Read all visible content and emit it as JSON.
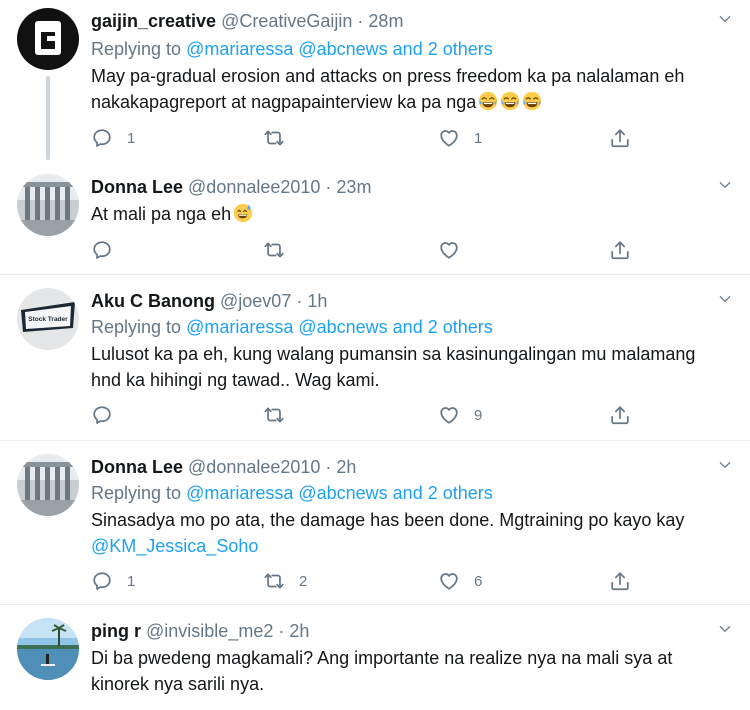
{
  "tweets": [
    {
      "name": "gaijin_creative",
      "handle": "@CreativeGaijin",
      "dot": " · ",
      "time": "28m",
      "replying_prefix": "Replying to ",
      "replying_users": "@mariaressa @abcnews and 2 others",
      "text_line1": "May pa-gradual erosion and attacks on press freedom ka pa nalalaman eh",
      "text_line2": "nakakapagreport at nagpapainterview ka pa nga",
      "emojis": [
        "face-with-tears-of-joy",
        "face-with-tears-of-joy",
        "face-with-tears-of-joy"
      ],
      "reply_count": "1",
      "retweet_count": "",
      "like_count": "1"
    },
    {
      "name": "Donna Lee",
      "handle": "@donnalee2010",
      "dot": " · ",
      "time": "23m",
      "text_line1": "At mali pa nga eh",
      "emojis": [
        "grinning-face-with-sweat"
      ],
      "reply_count": "",
      "retweet_count": "",
      "like_count": ""
    },
    {
      "name": "Aku C Banong",
      "handle": "@joev07",
      "dot": " · ",
      "time": "1h",
      "replying_prefix": "Replying to ",
      "replying_users": "@mariaressa @abcnews and 2 others",
      "text_line1": "Lulusot ka pa eh, kung walang pumansin sa kasinungalingan mu malamang",
      "text_line2": "hnd ka hihingi ng tawad.. Wag kami.",
      "avatar_text": "Stock Trader",
      "reply_count": "",
      "retweet_count": "",
      "like_count": "9"
    },
    {
      "name": "Donna Lee",
      "handle": "@donnalee2010",
      "dot": " · ",
      "time": "2h",
      "replying_prefix": "Replying to ",
      "replying_users": "@mariaressa @abcnews and 2 others",
      "text_line1": "Sinasadya mo po ata, the damage has been done. Mgtraining po kayo kay",
      "text_mention": "@KM_Jessica_Soho",
      "reply_count": "1",
      "retweet_count": "2",
      "like_count": "6"
    },
    {
      "name": "ping r",
      "handle": "@invisible_me2",
      "dot": " · ",
      "time": "2h",
      "text_line1": "Di ba pwedeng magkamali? Ang importante na realize nya na mali sya at",
      "text_line2": "kinorek nya sarili nya."
    }
  ],
  "colors": {
    "link": "#1da1f2",
    "secondary_text": "#657786",
    "primary_text": "#14171a",
    "separator": "#e6ecf0",
    "thread_line": "#ccd6dd"
  },
  "icons": [
    "reply-icon",
    "retweet-icon",
    "like-icon",
    "share-icon",
    "chevron-down-icon"
  ]
}
